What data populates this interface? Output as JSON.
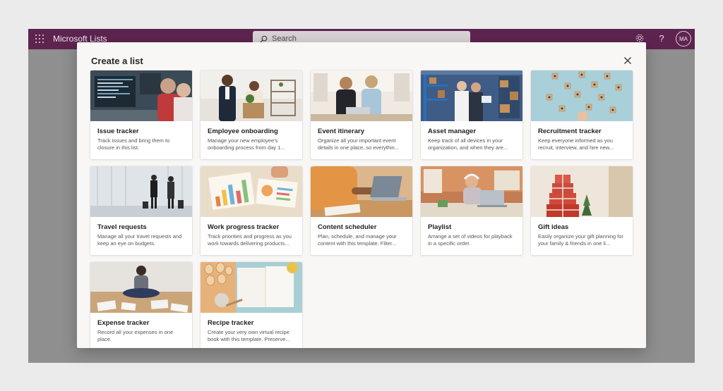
{
  "app": {
    "title": "Microsoft Lists",
    "search_placeholder": "Search",
    "avatar_initials": "MA",
    "help_glyph": "?"
  },
  "modal": {
    "title": "Create a list",
    "templates": [
      {
        "title": "Issue tracker",
        "description": "Track issues and bring them to closure in this list."
      },
      {
        "title": "Employee onboarding",
        "description": "Manage your new employee's onboarding process from day 1..."
      },
      {
        "title": "Event itinerary",
        "description": "Organize all your important event details in one place, so everythin..."
      },
      {
        "title": "Asset manager",
        "description": "Keep track of all devices in your organization, and when they are..."
      },
      {
        "title": "Recruitment tracker",
        "description": "Keep everyone informed as you recruit, interview, and hire new..."
      },
      {
        "title": "Travel requests",
        "description": "Manage all your travel requests and keep an eye on budgets."
      },
      {
        "title": "Work progress tracker",
        "description": "Track priorities and progress as you work towards delivering products..."
      },
      {
        "title": "Content scheduler",
        "description": "Plan, schedule, and manage your content with this template. Filter..."
      },
      {
        "title": "Playlist",
        "description": "Arrange a set of videos for playback in a specific order."
      },
      {
        "title": "Gift ideas",
        "description": "Easily organize your gift planning for your family & friends in one li..."
      },
      {
        "title": "Expense tracker",
        "description": "Record all your expenses in one place."
      },
      {
        "title": "Recipe tracker",
        "description": "Create your very own virtual recipe book with this template. Preserve..."
      }
    ]
  },
  "colors": {
    "suite_bar": "#5e2450",
    "overlay": "#8f8f8f",
    "modal_bg": "#f8f7f6"
  }
}
